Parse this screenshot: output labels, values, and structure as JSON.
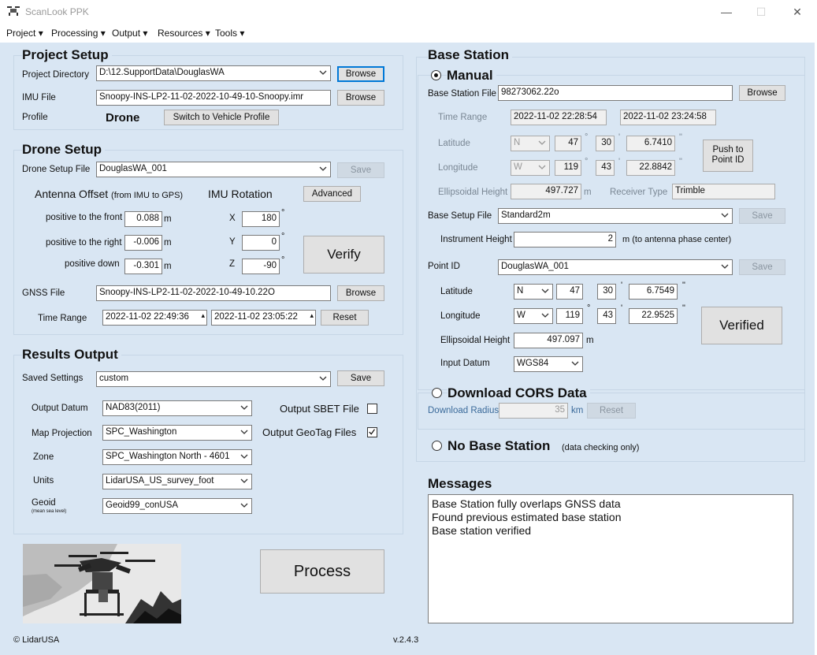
{
  "window": {
    "title": "ScanLook PPK",
    "minimize": "—",
    "maximize": "☐",
    "close": "✕"
  },
  "menu": [
    "Project",
    "Processing",
    "Output",
    "Resources",
    "Tools"
  ],
  "project_setup": {
    "title": "Project Setup",
    "directory_label": "Project Directory",
    "directory_value": "D:\\12.SupportData\\DouglasWA",
    "imu_label": "IMU File",
    "imu_value": "Snoopy-INS-LP2-11-02-2022-10-49-10-Snoopy.imr",
    "browse": "Browse",
    "profile_label": "Profile",
    "profile_value": "Drone",
    "switch_profile": "Switch to Vehicle Profile"
  },
  "drone_setup": {
    "title": "Drone Setup",
    "file_label": "Drone Setup File",
    "file_value": "DouglasWA_001",
    "save": "Save",
    "antenna_offset": "Antenna Offset",
    "antenna_offset_note": "(from IMU to GPS)",
    "imu_rotation": "IMU Rotation",
    "advanced": "Advanced",
    "front_label": "positive to the front",
    "front_value": "0.088",
    "right_label": "positive to the right",
    "right_value": "-0.006",
    "down_label": "positive down",
    "down_value": "-0.301",
    "unit_m": "m",
    "x_label": "X",
    "x_value": "180",
    "y_label": "Y",
    "y_value": "0",
    "z_label": "Z",
    "z_value": "-90",
    "degree": "°",
    "verify": "Verify",
    "gnss_label": "GNSS File",
    "gnss_value": "Snoopy-INS-LP2-11-02-2022-10-49-10.22O",
    "browse": "Browse",
    "time_range_label": "Time Range",
    "time_start": "2022-11-02 22:49:36",
    "time_end": "2022-11-02 23:05:22",
    "reset": "Reset"
  },
  "results_output": {
    "title": "Results Output",
    "saved_label": "Saved Settings",
    "saved_value": "custom",
    "save": "Save",
    "datum_label": "Output Datum",
    "datum_value": "NAD83(2011)",
    "projection_label": "Map Projection",
    "projection_value": "SPC_Washington",
    "zone_label": "Zone",
    "zone_value": "SPC_Washington North - 4601",
    "units_label": "Units",
    "units_value": "LidarUSA_US_survey_foot",
    "geoid_label": "Geoid",
    "geoid_sub": "(mean sea level)",
    "geoid_value": "Geoid99_conUSA",
    "sbet_label": "Output SBET File",
    "sbet_checked": false,
    "geotag_label": "Output GeoTag Files",
    "geotag_checked": true
  },
  "process": "Process",
  "footer": {
    "copyright": "© LidarUSA",
    "version": "v.2.4.3"
  },
  "base_station": {
    "title": "Base Station",
    "manual": "Manual",
    "file_label": "Base Station File",
    "file_value": "98273062.22o",
    "browse": "Browse",
    "time_range_label": "Time Range",
    "time_start": "2022-11-02 22:28:54",
    "time_end": "2022-11-02 23:24:58",
    "latitude_label": "Latitude",
    "lat_dir": "N",
    "lat_deg": "47",
    "lat_min": "30",
    "lat_sec": "6.7410",
    "longitude_label": "Longitude",
    "lon_dir": "W",
    "lon_deg": "119",
    "lon_min": "43",
    "lon_sec": "22.8842",
    "push_to_point": "Push to\nPoint ID",
    "ell_height_label": "Ellipsoidal Height",
    "ell_height_value": "497.727",
    "unit_m": "m",
    "receiver_label": "Receiver Type",
    "receiver_value": "Trimble",
    "base_setup_label": "Base Setup File",
    "base_setup_value": "Standard2m",
    "save": "Save",
    "instrument_label": "Instrument Height",
    "instrument_value": "2",
    "instrument_note": "m  (to antenna phase center)",
    "point_id_label": "Point ID",
    "point_id_value": "DouglasWA_001",
    "p_latitude_label": "Latitude",
    "p_lat_dir": "N",
    "p_lat_deg": "47",
    "p_lat_min": "30",
    "p_lat_sec": "6.7549",
    "p_longitude_label": "Longitude",
    "p_lon_dir": "W",
    "p_lon_deg": "119",
    "p_lon_min": "43",
    "p_lon_sec": "22.9525",
    "p_ell_label": "Ellipsoidal Height",
    "p_ell_value": "497.097",
    "input_datum_label": "Input Datum",
    "input_datum_value": "WGS84",
    "verified": "Verified",
    "degree": "°",
    "minute": "'",
    "second": "\"",
    "cors": "Download CORS Data",
    "radius_label": "Download Radius",
    "radius_value": "35",
    "radius_unit": "km",
    "reset": "Reset",
    "no_base": "No Base Station",
    "no_base_note": "(data checking only)"
  },
  "messages": {
    "title": "Messages",
    "lines": [
      "Base Station fully overlaps GNSS data",
      "Found previous estimated base station",
      "Base station verified"
    ]
  }
}
